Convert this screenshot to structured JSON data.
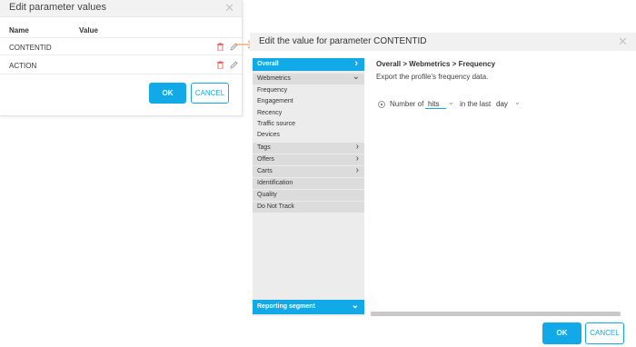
{
  "left_dialog": {
    "title": "Edit parameter values",
    "columns": {
      "name": "Name",
      "value": "Value"
    },
    "rows": [
      {
        "name": "CONTENTID",
        "value": ""
      },
      {
        "name": "ACTION",
        "value": ""
      }
    ],
    "ok_label": "OK",
    "cancel_label": "CANCEL"
  },
  "right_dialog": {
    "title": "Edit the value for parameter CONTENTID",
    "sidebar": {
      "overall": "Overall",
      "webmetrics": "Webmetrics",
      "webmetrics_items": [
        "Frequency",
        "Engagement",
        "Recency",
        "Traffic source",
        "Devices"
      ],
      "tags": "Tags",
      "offers": "Offers",
      "carts": "Carts",
      "other_items": [
        "Identification",
        "Quality",
        "Do Not Track"
      ],
      "reporting_segment": "Reporting segment"
    },
    "content": {
      "breadcrumb": "Overall > Webmetrics > Frequency",
      "description": "Export the profile's frequency data.",
      "number_of_label": "Number of",
      "metric_value": "hits",
      "in_the_last_label": "in the last",
      "period_value": "day"
    },
    "ok_label": "OK",
    "cancel_label": "CANCEL"
  },
  "colors": {
    "accent": "#12a9e8",
    "arrow": "#f0a060",
    "trash": "#e8706a"
  }
}
